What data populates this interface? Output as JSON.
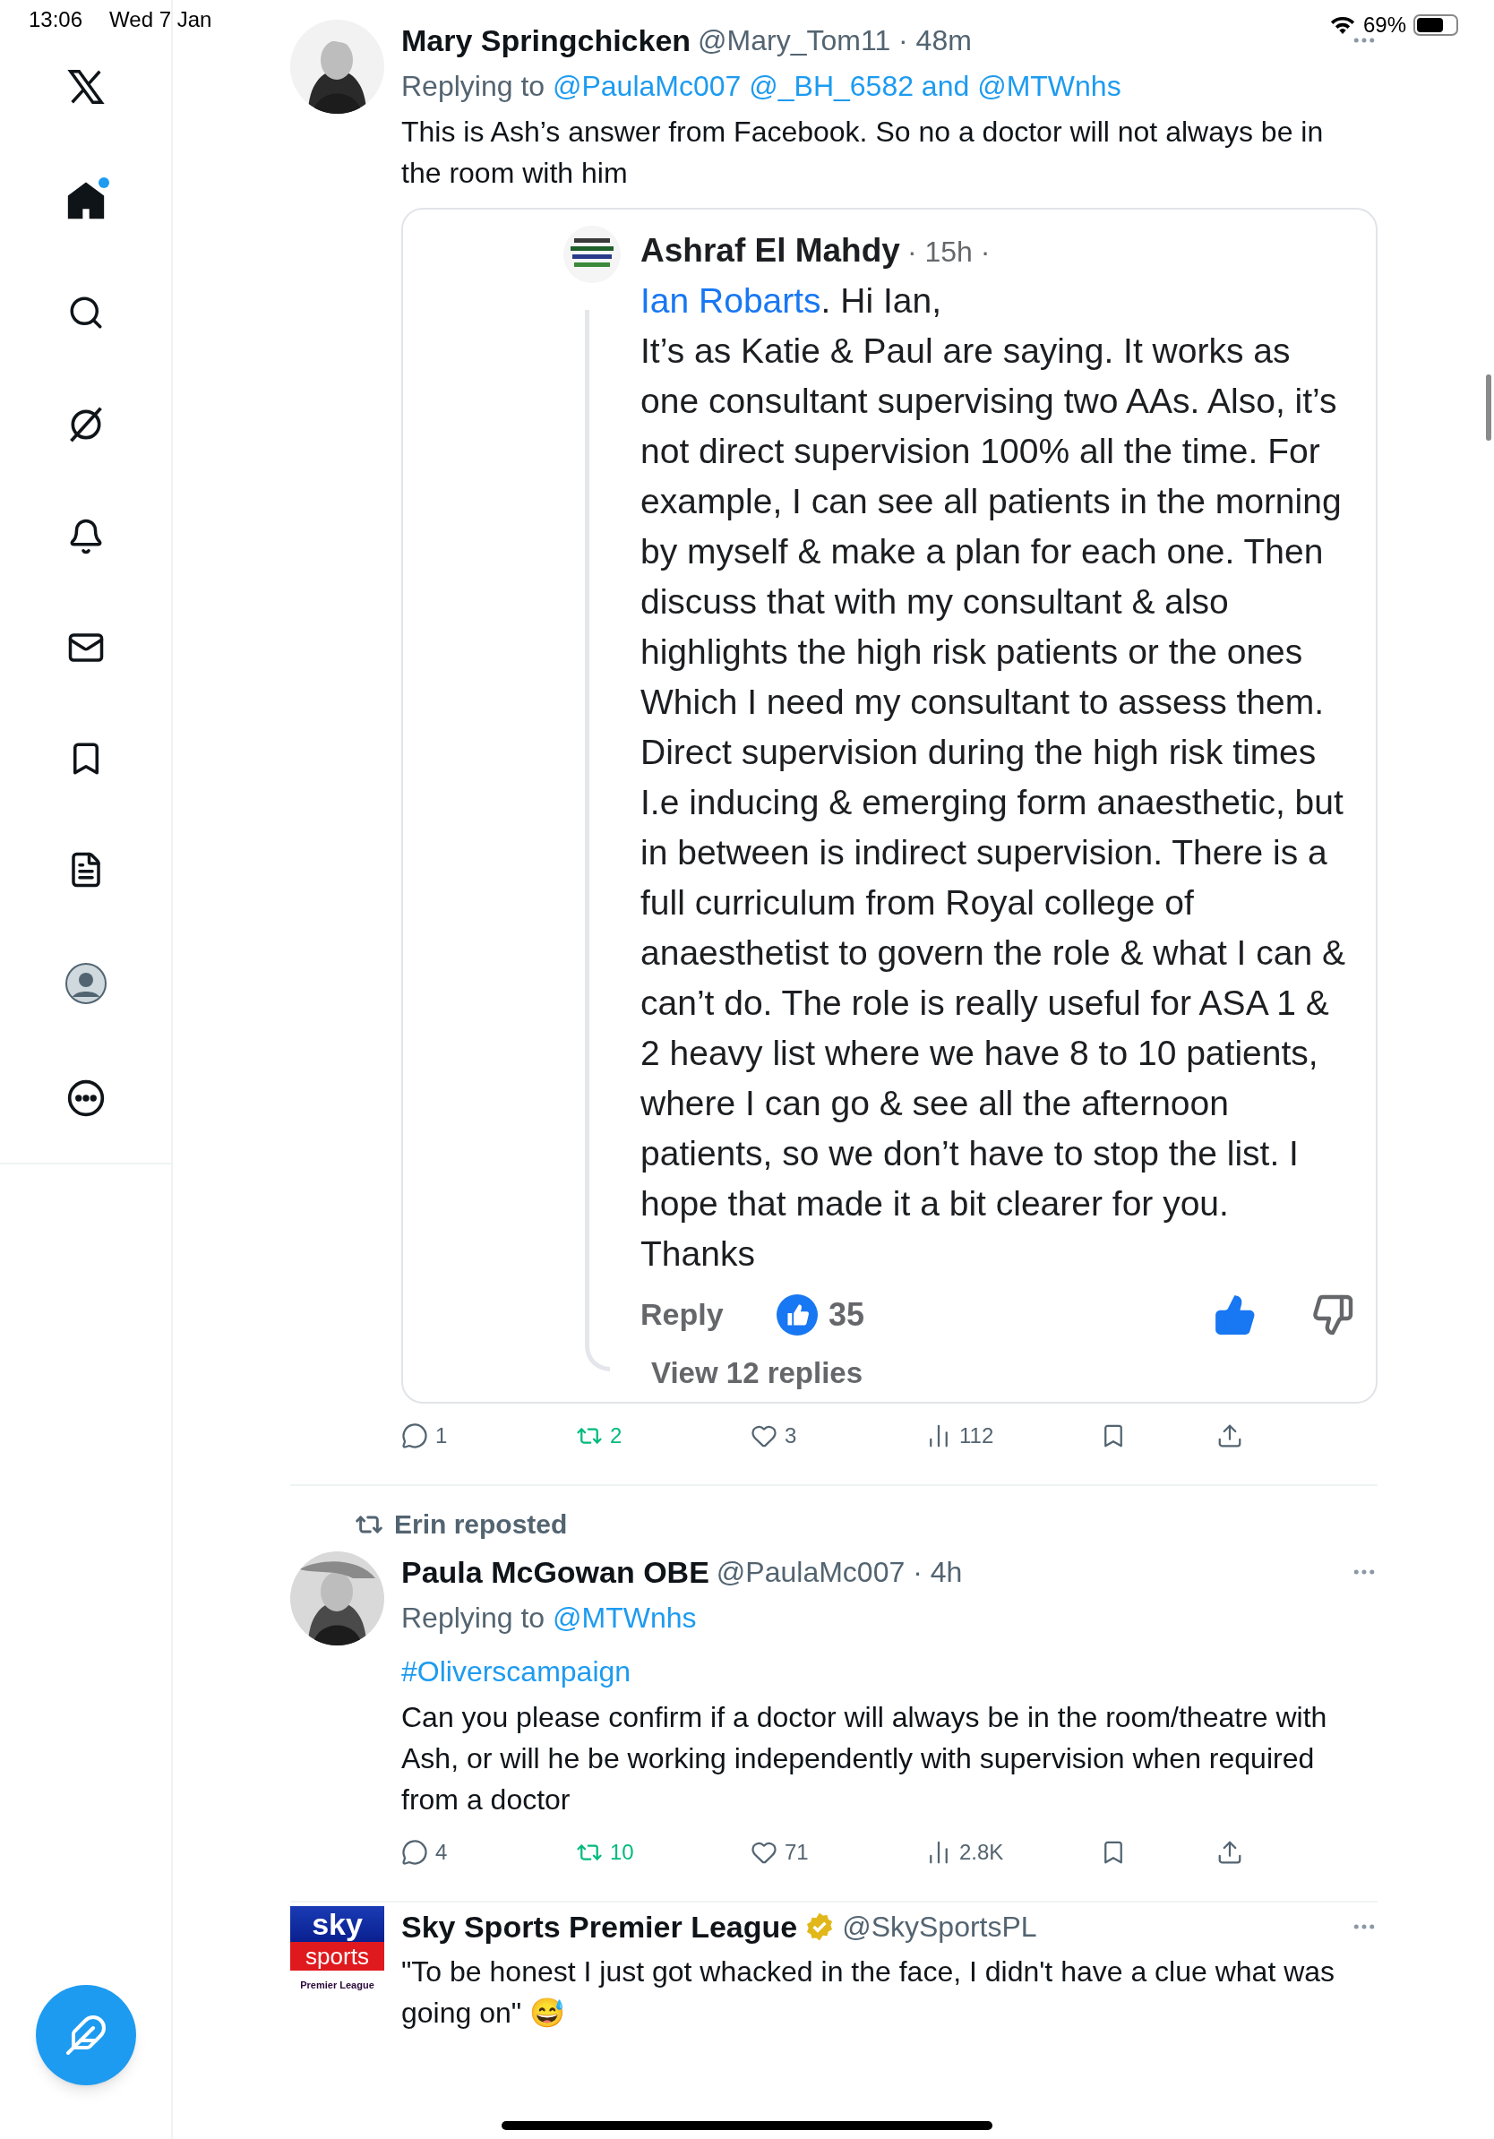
{
  "status_bar": {
    "time": "13:06",
    "date": "Wed 7 Jan",
    "battery": "69%"
  },
  "sidebar": {
    "items": [
      {
        "kind": "logo",
        "selected": false
      },
      {
        "kind": "home",
        "selected": true,
        "badge": true
      },
      {
        "kind": "search",
        "selected": false
      },
      {
        "kind": "grok",
        "selected": false
      },
      {
        "kind": "notifications",
        "selected": false
      },
      {
        "kind": "messages",
        "selected": false
      },
      {
        "kind": "bookmarks",
        "selected": false
      },
      {
        "kind": "lists",
        "selected": false
      },
      {
        "kind": "profile",
        "selected": false
      },
      {
        "kind": "more",
        "selected": false
      }
    ]
  },
  "posts": [
    {
      "name": "Mary Springchicken",
      "handle": "@Mary_Tom11",
      "time": "· 48m",
      "replying_prefix": "Replying to",
      "replying_to": [
        "@PaulaMc007",
        "@_BH_6582",
        "@MTWnhs"
      ],
      "replying_joiner": "and",
      "text": "This is Ash’s answer from Facebook. So no a doctor will not always be in the room with him",
      "quote": {
        "name": "Ashraf El Mahdy",
        "time": "· 15h ·",
        "mention": "Ian Robarts",
        "greeting": ". Hi Ian,",
        "text": "It’s as Katie & Paul are saying. It works as one consultant supervising two AAs. Also, it’s not direct supervision 100% all the time. For example, I can see all patients in the morning by myself & make a plan for each one. Then discuss that with my consultant & also highlights the high risk patients or the ones Which I need my consultant to assess them. Direct supervision during the high risk times I.e inducing & emerging form anaesthetic, but in between is indirect supervision. There is a full curriculum from Royal college of anaesthetist to govern the role & what I can & can’t do. The role is really useful for ASA 1 & 2 heavy list where we have 8 to 10 patients, where I can go & see all the afternoon patients, so we don’t have to stop the list. I hope that made it a bit clearer for you. Thanks",
        "reply": "Reply",
        "likes": "35",
        "liked": true,
        "view_replies": "View 12 replies"
      },
      "actions": {
        "replies": "1",
        "reposts": "2",
        "reposted": true,
        "likes": "3",
        "views": "112"
      }
    },
    {
      "repost_label": "Erin reposted",
      "name": "Paula McGowan OBE",
      "handle": "@PaulaMc007",
      "time": "· 4h",
      "replying_prefix": "Replying to",
      "replying_to": [
        "@MTWnhs"
      ],
      "hashtag": "#Oliverscampaign",
      "text": "Can you please confirm if a doctor will always be in the room/theatre with Ash, or will he be working independently with supervision when required from a doctor",
      "actions": {
        "replies": "4",
        "reposts": "10",
        "reposted": true,
        "likes": "71",
        "views": "2.8K"
      }
    },
    {
      "avatar": {
        "kind": "logo",
        "top": "sky",
        "middle": "sports",
        "bottom": "Premier League"
      },
      "name": "Sky Sports Premier League",
      "handle": "@SkySportsPL",
      "verified": true,
      "text": "\"To be honest I just got whacked in the face, I didn't have a clue what was going on\" 😅"
    }
  ]
}
